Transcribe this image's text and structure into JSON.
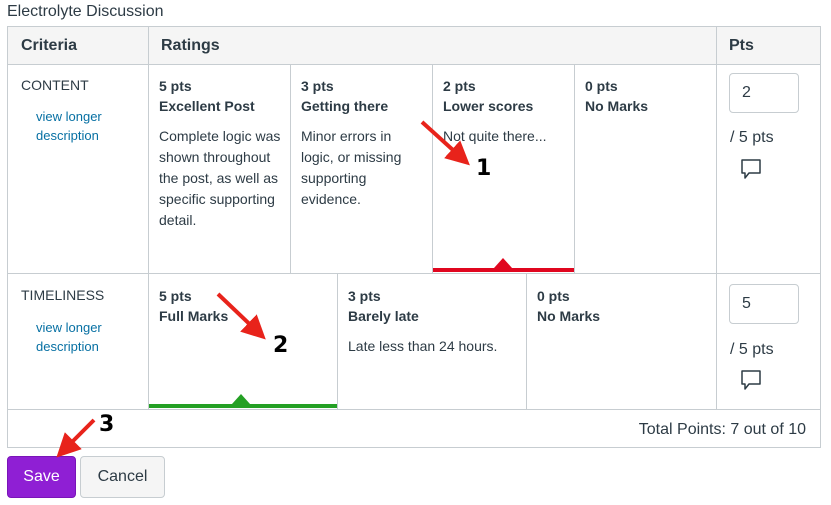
{
  "title": "Electrolyte Discussion",
  "headers": {
    "criteria": "Criteria",
    "ratings": "Ratings",
    "pts": "Pts"
  },
  "criteria": [
    {
      "name": "CONTENT",
      "link": "view longer description",
      "ratings": [
        {
          "pts": "5 pts",
          "desc": "Excellent Post",
          "long": "Complete logic was shown throughout the post, as well as specific supporting detail."
        },
        {
          "pts": "3 pts",
          "desc": "Getting there",
          "long": "Minor errors in logic, or missing supporting evidence."
        },
        {
          "pts": "2 pts",
          "desc": "Lower scores",
          "long": "Not quite there..."
        },
        {
          "pts": "0 pts",
          "desc": "No Marks",
          "long": ""
        }
      ],
      "selected_index": 2,
      "selected_color": "#e0061f",
      "score": "2",
      "out_of": "/ 5 pts"
    },
    {
      "name": "TIMELINESS",
      "link": "view longer description",
      "ratings": [
        {
          "pts": "5 pts",
          "desc": "Full Marks",
          "long": ""
        },
        {
          "pts": "3 pts",
          "desc": "Barely late",
          "long": "Late less than 24 hours."
        },
        {
          "pts": "0 pts",
          "desc": "No Marks",
          "long": ""
        }
      ],
      "selected_index": 0,
      "selected_color": "#24a024",
      "score": "5",
      "out_of": "/ 5 pts"
    }
  ],
  "total": "Total Points: 7 out of 10",
  "buttons": {
    "save": "Save",
    "cancel": "Cancel"
  },
  "annotations": {
    "one": "1",
    "two": "2",
    "three": "3",
    "arrow_color": "#e8231b"
  },
  "icons": {
    "comment": "comment-icon"
  }
}
